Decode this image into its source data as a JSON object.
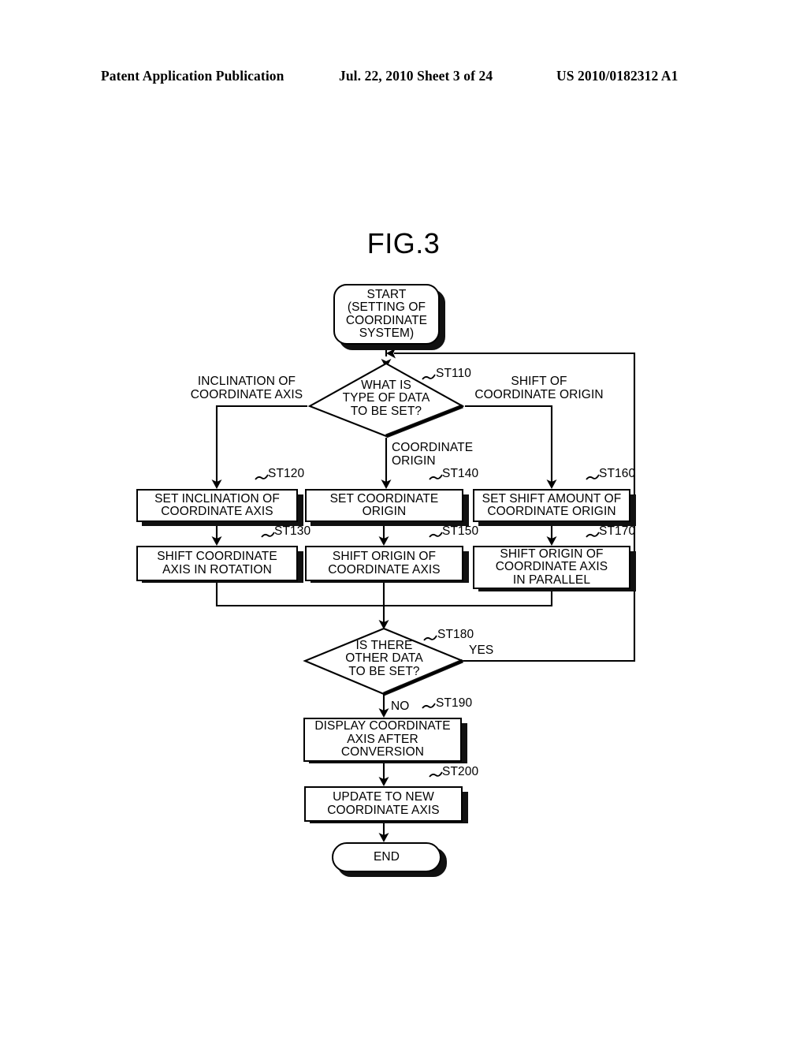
{
  "header": {
    "left": "Patent Application Publication",
    "middle": "Jul. 22, 2010   Sheet 3 of 24",
    "right": "US 2010/0182312 A1"
  },
  "figure": {
    "title": "FIG.3"
  },
  "nodes": {
    "start": {
      "type": "terminator",
      "lines": [
        "START",
        "(SETTING OF",
        "COORDINATE",
        "SYSTEM)"
      ]
    },
    "st110": {
      "type": "decision",
      "tag": "ST110",
      "lines": [
        "WHAT IS",
        "TYPE OF DATA",
        "TO BE SET?"
      ]
    },
    "st120": {
      "type": "process",
      "tag": "ST120",
      "lines": [
        "SET INCLINATION OF",
        "COORDINATE AXIS"
      ]
    },
    "st130": {
      "type": "process",
      "tag": "ST130",
      "lines": [
        "SHIFT COORDINATE",
        "AXIS IN ROTATION"
      ]
    },
    "st140": {
      "type": "process",
      "tag": "ST140",
      "lines": [
        "SET COORDINATE",
        "ORIGIN"
      ]
    },
    "st150": {
      "type": "process",
      "tag": "ST150",
      "lines": [
        "SHIFT ORIGIN OF",
        "COORDINATE AXIS"
      ]
    },
    "st160": {
      "type": "process",
      "tag": "ST160",
      "lines": [
        "SET SHIFT AMOUNT OF",
        "COORDINATE ORIGIN"
      ]
    },
    "st170": {
      "type": "process",
      "tag": "ST170",
      "lines": [
        "SHIFT ORIGIN OF",
        "COORDINATE AXIS",
        "IN PARALLEL"
      ]
    },
    "st180": {
      "type": "decision",
      "tag": "ST180",
      "lines": [
        "IS THERE",
        "OTHER DATA",
        "TO BE SET?"
      ]
    },
    "st190": {
      "type": "process",
      "tag": "ST190",
      "lines": [
        "DISPLAY COORDINATE",
        "AXIS AFTER",
        "CONVERSION"
      ]
    },
    "st200": {
      "type": "process",
      "tag": "ST200",
      "lines": [
        "UPDATE TO NEW",
        "COORDINATE AXIS"
      ]
    },
    "end": {
      "type": "terminator",
      "lines": [
        "END"
      ]
    }
  },
  "edge_labels": {
    "branch_left": [
      "INCLINATION OF",
      "COORDINATE AXIS"
    ],
    "branch_center": [
      "COORDINATE",
      "ORIGIN"
    ],
    "branch_right": [
      "SHIFT OF",
      "COORDINATE ORIGIN"
    ],
    "yes": "YES",
    "no": "NO"
  },
  "colors": {
    "ink": "#000000",
    "paper": "#ffffff"
  }
}
